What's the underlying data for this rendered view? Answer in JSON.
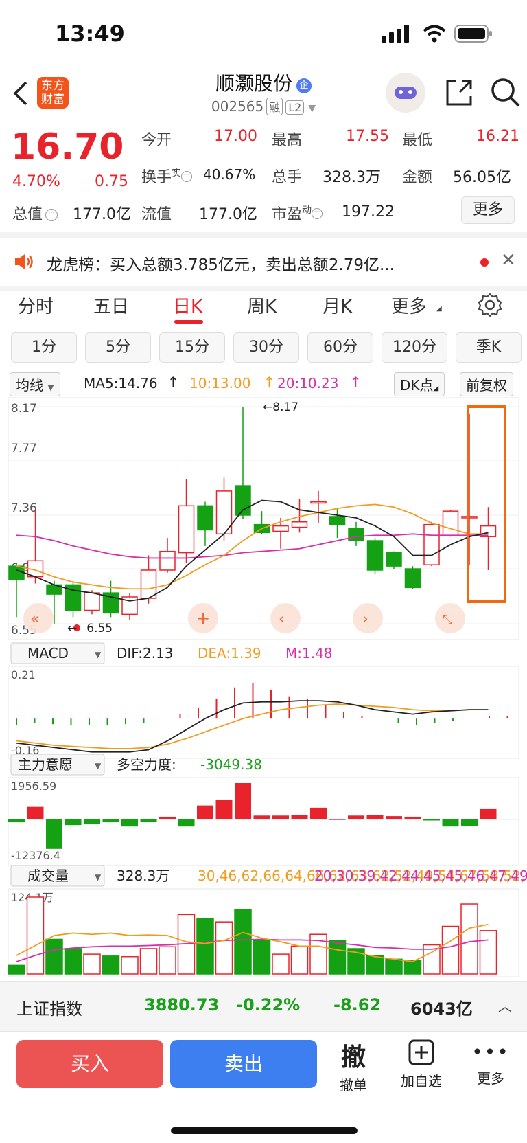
{
  "status_bar": {
    "time": "13:49"
  },
  "header": {
    "logo_text": "东方财富",
    "stock_name": "顺灏股份",
    "stock_code": "002565",
    "badge_rong": "融",
    "badge_l2": "L2"
  },
  "quote": {
    "price": "16.70",
    "change_pct": "4.70%",
    "change": "0.75",
    "open_label": "今开",
    "open": "17.00",
    "high_label": "最高",
    "high": "17.55",
    "low_label": "最低",
    "low": "16.21",
    "turnover_label": "换手",
    "turnover_sup": "实",
    "turnover": "40.67%",
    "volume_label": "总手",
    "volume": "328.3万",
    "amount_label": "金额",
    "amount": "56.05亿",
    "mktcap_label": "总值",
    "mktcap": "177.0亿",
    "float_label": "流值",
    "float": "177.0亿",
    "pe_label": "市盈",
    "pe_sup": "动",
    "pe": "197.22",
    "more_label": "更多"
  },
  "notice": {
    "text": "龙虎榜：买入总额3.785亿元，卖出总额2.79亿..."
  },
  "tabs": [
    "分时",
    "五日",
    "日K",
    "周K",
    "月K",
    "更多"
  ],
  "active_tab": "日K",
  "periods": [
    "1分",
    "5分",
    "15分",
    "30分",
    "60分",
    "120分",
    "季K"
  ],
  "kline_header": {
    "ma_select": "均线",
    "ma5": "MA5:14.76",
    "ma10": "10:13.00",
    "ma20": "20:10.23",
    "dk_button": "DK点",
    "adjust_button": "前复权"
  },
  "colors": {
    "up": "#e8232b",
    "down": "#14a214",
    "ma5": "#222222",
    "ma10": "#f29c1f",
    "ma20": "#d62fa9",
    "highlight": "#f06a0f"
  },
  "chart_data": [
    {
      "type": "candlestick",
      "y_ticks": [
        "8.17",
        "7.77",
        "7.36",
        "6.96",
        "6.55"
      ],
      "ylim": [
        6.55,
        8.17
      ],
      "annotations": {
        "max": "8.17",
        "min": "6.55"
      },
      "candles": [
        {
          "o": 6.98,
          "c": 6.88,
          "h": 7.0,
          "l": 6.6
        },
        {
          "o": 6.9,
          "c": 7.02,
          "h": 7.4,
          "l": 6.85
        },
        {
          "o": 6.84,
          "c": 6.77,
          "h": 6.87,
          "l": 6.55
        },
        {
          "o": 6.84,
          "c": 6.65,
          "h": 6.87,
          "l": 6.6
        },
        {
          "o": 6.65,
          "c": 6.78,
          "h": 6.8,
          "l": 6.62
        },
        {
          "o": 6.78,
          "c": 6.63,
          "h": 6.87,
          "l": 6.6
        },
        {
          "o": 6.62,
          "c": 6.75,
          "h": 6.78,
          "l": 6.58
        },
        {
          "o": 6.74,
          "c": 6.95,
          "h": 7.06,
          "l": 6.7
        },
        {
          "o": 6.95,
          "c": 7.09,
          "h": 7.19,
          "l": 6.93
        },
        {
          "o": 7.08,
          "c": 7.43,
          "h": 7.63,
          "l": 7.0
        },
        {
          "o": 7.43,
          "c": 7.25,
          "h": 7.46,
          "l": 7.13
        },
        {
          "o": 7.22,
          "c": 7.54,
          "h": 7.64,
          "l": 7.17
        },
        {
          "o": 7.58,
          "c": 7.36,
          "h": 8.17,
          "l": 7.33
        },
        {
          "o": 7.29,
          "c": 7.23,
          "h": 7.39,
          "l": 7.22
        },
        {
          "o": 7.24,
          "c": 7.28,
          "h": 7.34,
          "l": 7.11
        },
        {
          "o": 7.27,
          "c": 7.31,
          "h": 7.48,
          "l": 7.23
        },
        {
          "o": 7.45,
          "c": 7.46,
          "h": 7.54,
          "l": 7.3
        },
        {
          "o": 7.35,
          "c": 7.29,
          "h": 7.41,
          "l": 7.19
        },
        {
          "o": 7.26,
          "c": 7.17,
          "h": 7.31,
          "l": 7.13
        },
        {
          "o": 7.17,
          "c": 6.95,
          "h": 7.19,
          "l": 6.92
        },
        {
          "o": 7.08,
          "c": 6.98,
          "h": 7.09,
          "l": 6.96
        },
        {
          "o": 6.96,
          "c": 6.82,
          "h": 6.98,
          "l": 6.81
        },
        {
          "o": 6.99,
          "c": 7.29,
          "h": 7.31,
          "l": 6.98
        },
        {
          "o": 7.21,
          "c": 7.39,
          "h": 7.4,
          "l": 7.2
        },
        {
          "o": 7.35,
          "c": 7.35,
          "h": 8.12,
          "l": 6.99
        },
        {
          "o": 7.2,
          "c": 7.28,
          "h": 7.42,
          "l": 6.95
        }
      ],
      "ma5": [
        6.95,
        6.9,
        6.84,
        6.8,
        6.78,
        6.75,
        6.72,
        6.74,
        6.82,
        6.98,
        7.1,
        7.22,
        7.4,
        7.47,
        7.46,
        7.4,
        7.38,
        7.36,
        7.34,
        7.28,
        7.2,
        7.06,
        7.06,
        7.14,
        7.2,
        7.23
      ],
      "ma10": [
        6.98,
        6.95,
        6.9,
        6.86,
        6.84,
        6.82,
        6.81,
        6.81,
        6.84,
        6.91,
        6.99,
        7.06,
        7.17,
        7.26,
        7.31,
        7.35,
        7.38,
        7.41,
        7.43,
        7.44,
        7.42,
        7.37,
        7.3,
        7.26,
        7.22,
        7.22
      ],
      "ma20": [
        7.21,
        7.2,
        7.17,
        7.13,
        7.1,
        7.07,
        7.05,
        7.04,
        7.04,
        7.04,
        7.05,
        7.06,
        7.08,
        7.09,
        7.1,
        7.11,
        7.14,
        7.17,
        7.2,
        7.21,
        7.21,
        7.22,
        7.21,
        7.21,
        7.21,
        7.21
      ]
    },
    {
      "type": "bar",
      "name": "MACD",
      "dif": "DIF:2.13",
      "dea": "DEA:1.39",
      "m": "M:1.48",
      "y_ticks": [
        "0.21",
        "-0.16"
      ],
      "ylim": [
        -0.16,
        0.21
      ],
      "hist": [
        -0.03,
        -0.02,
        -0.025,
        -0.03,
        -0.03,
        -0.03,
        -0.025,
        -0.02,
        0.0,
        0.02,
        0.05,
        0.09,
        0.14,
        0.16,
        0.13,
        0.1,
        0.09,
        0.06,
        0.03,
        0.01,
        0.0,
        -0.02,
        -0.03,
        -0.02,
        -0.01,
        0.0,
        0.01,
        0.01
      ],
      "dif_line": [
        -0.11,
        -0.12,
        -0.13,
        -0.14,
        -0.15,
        -0.15,
        -0.15,
        -0.14,
        -0.1,
        -0.05,
        0.0,
        0.04,
        0.07,
        0.075,
        0.075,
        0.08,
        0.08,
        0.075,
        0.06,
        0.04,
        0.03,
        0.02,
        0.03,
        0.035,
        0.04,
        0.04
      ],
      "dea_line": [
        -0.1,
        -0.11,
        -0.12,
        -0.125,
        -0.13,
        -0.135,
        -0.135,
        -0.13,
        -0.115,
        -0.09,
        -0.06,
        -0.03,
        0.0,
        0.02,
        0.04,
        0.05,
        0.06,
        0.065,
        0.06,
        0.055,
        0.05,
        0.04,
        0.035,
        0.035,
        0.04,
        0.04
      ]
    },
    {
      "type": "bar",
      "name": "主力意愿",
      "label": "多空力度:",
      "value": "-3049.38",
      "y_ticks": [
        "1956.59",
        "-12376.4"
      ],
      "ylim": [
        -12376.4,
        1956.59
      ],
      "values": [
        -100,
        450,
        -1050,
        -200,
        -150,
        -100,
        -250,
        -100,
        100,
        -250,
        500,
        700,
        1300,
        140,
        140,
        160,
        420,
        20,
        140,
        160,
        120,
        100,
        -30,
        -250,
        -230,
        370
      ]
    },
    {
      "type": "bar",
      "name": "成交量",
      "value": "328.3万",
      "ma1": [
        30,
        46,
        62,
        66,
        64,
        66,
        62,
        63,
        62,
        52,
        49,
        54,
        67,
        58,
        52,
        45,
        45,
        39,
        35,
        28,
        24,
        20,
        35,
        53,
        74,
        80
      ],
      "ma2": [
        20,
        30,
        39,
        42,
        44,
        45,
        45,
        46,
        47,
        49,
        51,
        54,
        55,
        56,
        55,
        55,
        54,
        50,
        47,
        43,
        42,
        40,
        40,
        44,
        52,
        55
      ],
      "y_ticks": [
        "124.1万"
      ],
      "ylim": [
        0,
        124.1
      ],
      "values": [
        14,
        124.1,
        56,
        41,
        32,
        29,
        28,
        41,
        44,
        96,
        90,
        84,
        104,
        55,
        32,
        45,
        64,
        54,
        41,
        30,
        24,
        22,
        47,
        77,
        113,
        70
      ]
    }
  ],
  "index_bar": {
    "name": "上证指数",
    "value": "3880.73",
    "pct": "-0.22%",
    "change": "-8.62",
    "amount": "6043亿"
  },
  "actions": {
    "buy": "买入",
    "sell": "卖出",
    "cancel_icon": "撤",
    "cancel": "撤单",
    "add": "加自选",
    "more": "更多"
  }
}
